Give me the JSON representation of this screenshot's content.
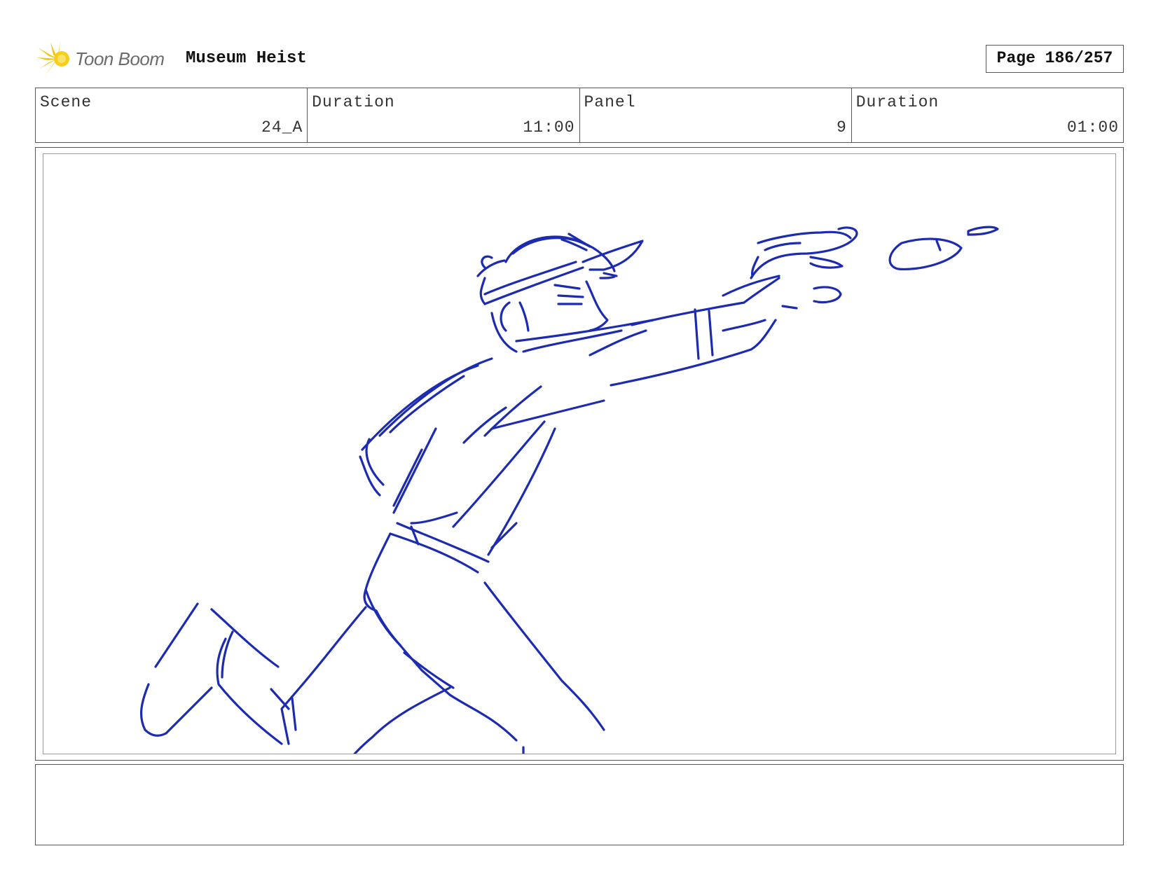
{
  "header": {
    "logo_text": "Toon Boom",
    "project_title": "Museum Heist",
    "page_counter": "Page 186/257"
  },
  "info": {
    "scene_label": "Scene",
    "scene_value": "24_A",
    "scene_duration_label": "Duration",
    "scene_duration_value": "11:00",
    "panel_label": "Panel",
    "panel_value": "9",
    "panel_duration_label": "Duration",
    "panel_duration_value": "01:00"
  },
  "colors": {
    "sketch_stroke": "#1c2bb0",
    "logo_yellow": "#f5c400"
  },
  "notes": {
    "text": ""
  }
}
